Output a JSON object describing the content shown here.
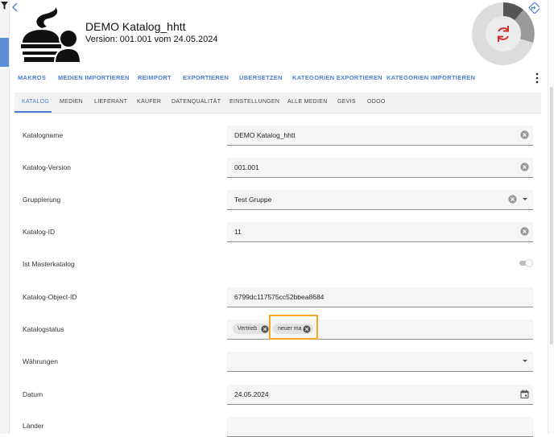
{
  "header": {
    "title": "DEMO Katalog_hhtt",
    "version": "Version: 001.001 vom 24.05.2024"
  },
  "toolbar": {
    "items": [
      "MAKROS",
      "MEDIEN IMPORTIEREN",
      "REIMPORT",
      "EXPORTIEREN",
      "ÜBERSETZEN",
      "KATEGORIEN EXPORTIEREN",
      "KATEGORIEN IMPORTIEREN"
    ]
  },
  "tabs": {
    "items": [
      "KATALOG",
      "MEDIEN",
      "LIEFERANT",
      "KÄUFER",
      "DATENQUALITÄT",
      "EINSTELLUNGEN",
      "ALLE MEDIEN",
      "GEVIS",
      "ODOO"
    ],
    "active": "KATALOG"
  },
  "form": {
    "katalogname": {
      "label": "Katalogname",
      "value": "DEMO Katalog_hhtt"
    },
    "katalog_version": {
      "label": "Katalog-Version",
      "value": "001.001"
    },
    "gruppierung": {
      "label": "Gruppierung",
      "value": "Test Gruppe"
    },
    "katalog_id": {
      "label": "Katalog-ID",
      "value": "11"
    },
    "ist_masterkatalog": {
      "label": "Ist Masterkatalog",
      "value": false
    },
    "katalog_object_id": {
      "label": "Katalog-Object-ID",
      "value": "6799dc117575cc52bbea8684"
    },
    "katalogstatus": {
      "label": "Katalogstatus",
      "chips": [
        "Vertrieb",
        "neuer ma"
      ]
    },
    "waehrungen": {
      "label": "Währungen",
      "value": ""
    },
    "datum": {
      "label": "Datum",
      "value": "24.05.2024"
    },
    "laender": {
      "label": "Länder",
      "value": ""
    }
  },
  "colors": {
    "accent": "#4a7fd0",
    "highlight": "#f5a623",
    "gauge_dark": "#555555",
    "gauge_mid": "#9a9a9a",
    "gauge_light": "#dcdcdc",
    "refresh_icon": "#d32f2f"
  },
  "icons": [
    "filter-icon",
    "back-arrow-icon",
    "share-icon",
    "refresh-icon",
    "kebab-menu-icon",
    "clear-icon",
    "dropdown-arrow-icon",
    "calendar-icon",
    "toggle-switch"
  ]
}
